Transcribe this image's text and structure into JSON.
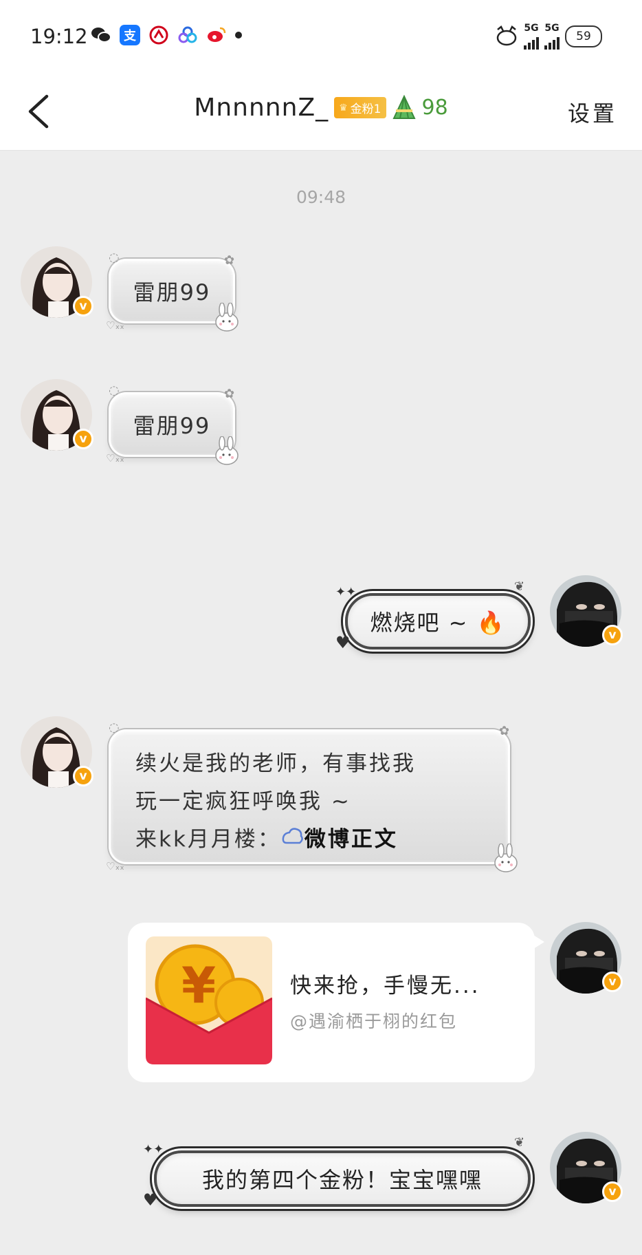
{
  "status_bar": {
    "time": "19:12",
    "network_1": "5G",
    "network_2": "5G",
    "battery": "59"
  },
  "header": {
    "title": "MnnnnnZ_",
    "fan_badge": "金粉1",
    "fan_score": "98",
    "settings_label": "设置"
  },
  "chat": {
    "timestamp": "09:48",
    "messages": [
      {
        "side": "left",
        "text": "雷朋99"
      },
      {
        "side": "left",
        "text": "雷朋99"
      },
      {
        "side": "right",
        "text": "燃烧吧 ~ 🔥"
      },
      {
        "side": "left",
        "lines": [
          "续火是我的老师，有事找我",
          "玩一定疯狂呼唤我 ~",
          "来kk月月楼："
        ],
        "link_text": "微博正文"
      },
      {
        "side": "right",
        "type": "red_packet",
        "title": "快来抢，手慢无...",
        "subtitle": "@遇渝栖于栩的红包"
      },
      {
        "side": "right",
        "text": "我的第四个金粉！宝宝嘿嘿"
      }
    ]
  },
  "colors": {
    "fan_badge": "#f7a81b",
    "fan_score": "#4a9b3b",
    "verified_badge": "#f6a20e",
    "packet_red": "#e8304a"
  }
}
